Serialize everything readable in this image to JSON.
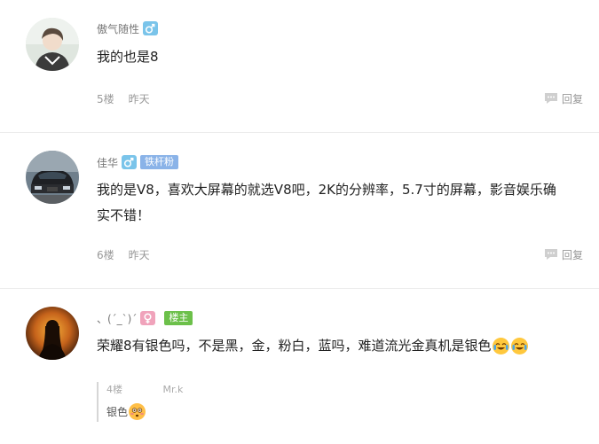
{
  "comments": [
    {
      "username": "傲气随性",
      "gender": "male",
      "content": "我的也是8",
      "floor": "5楼",
      "time": "昨天",
      "reply_label": "回复"
    },
    {
      "username": "佳华",
      "gender": "male",
      "badge": "铁杆粉",
      "content_line1": "我的是V8，喜欢大屏幕的就选V8吧，2K的分辨率，5.7寸的屏幕，影音娱乐确",
      "content_line2": "实不错！",
      "floor": "6楼",
      "time": "昨天",
      "reply_label": "回复"
    },
    {
      "username": "、(ˊ_ˋ)ˊ",
      "gender": "female",
      "badge": "楼主",
      "content": "荣耀8有银色吗，不是黑，金，粉白，蓝吗，难道流光金真机是银色",
      "emoji": "crying-laughing-emoji",
      "sub_reply": {
        "floor": "4楼",
        "username": "Mr.k",
        "text": "银色",
        "emoji": "flushed-emoji"
      }
    }
  ],
  "colors": {
    "male_badge": "#7ac4ea",
    "female_badge": "#f0a3bb",
    "fan_tag": "#8ab3e8",
    "op_tag": "#6cc04a",
    "divider": "#ececec"
  }
}
